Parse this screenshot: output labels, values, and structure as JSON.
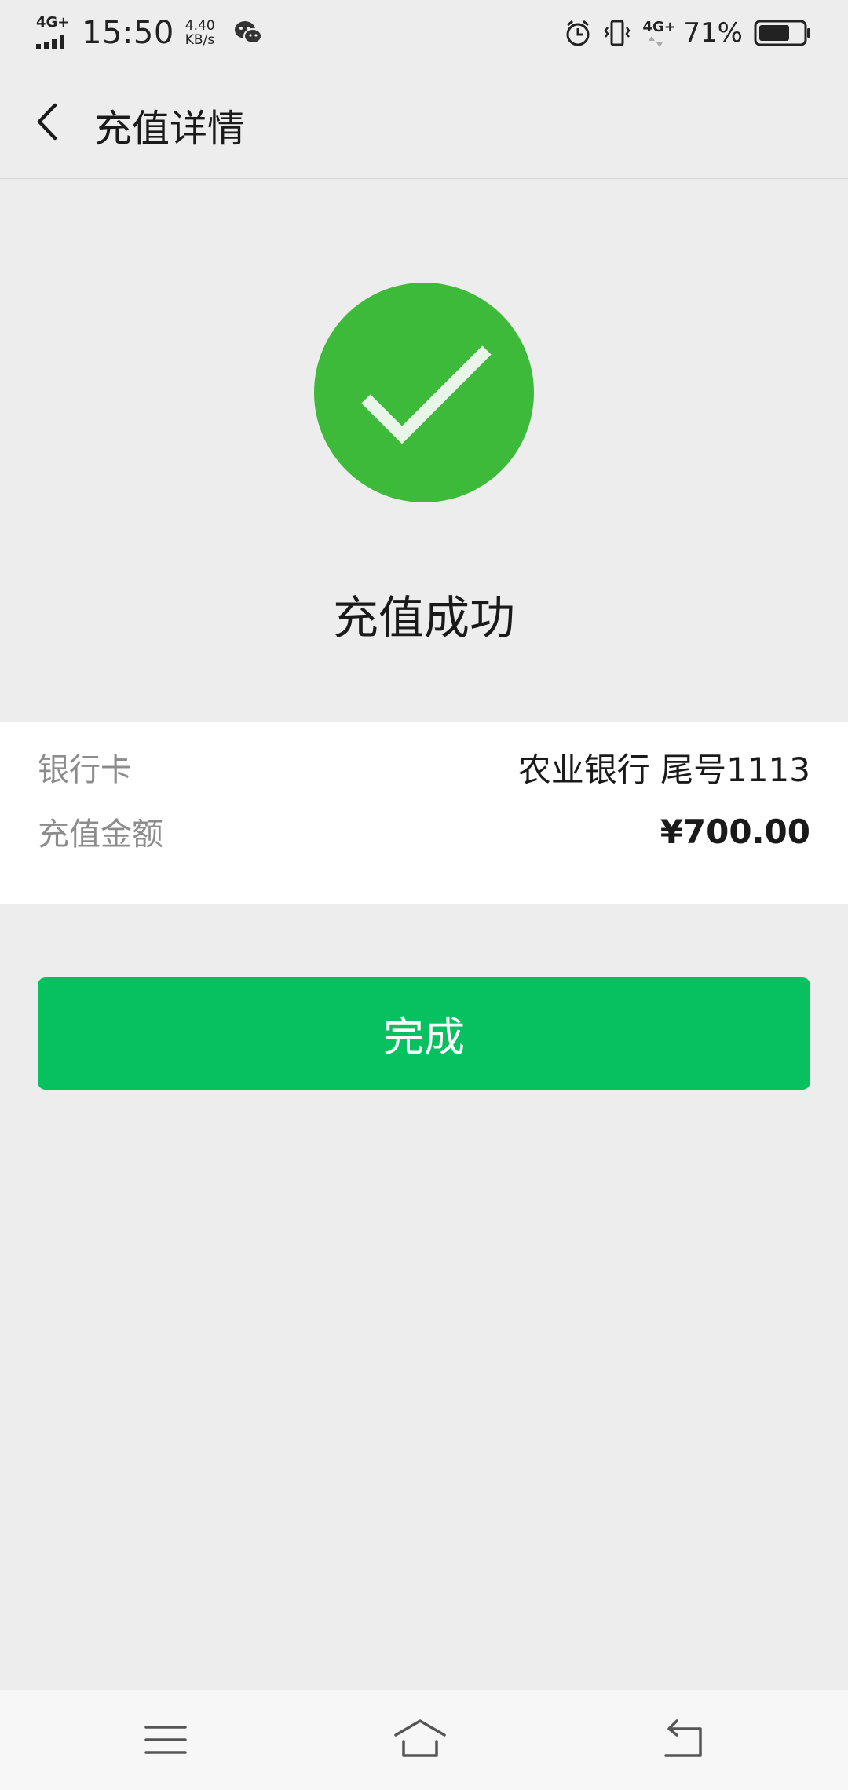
{
  "status_bar": {
    "network": "4G+",
    "time": "15:50",
    "speed_value": "4.40",
    "speed_unit": "KB/s",
    "network_right": "4G+",
    "battery_percent": "71%",
    "battery_level": 0.71,
    "icons": [
      "signal-icon",
      "wechat-icon",
      "alarm-icon",
      "vibrate-icon",
      "battery-icon"
    ]
  },
  "nav": {
    "back_icon": "chevron-left-icon",
    "title": "充值详情"
  },
  "result": {
    "icon": "check-circle-icon",
    "title": "充值成功",
    "accent_color": "#3dba3a"
  },
  "details": {
    "rows": [
      {
        "label": "银行卡",
        "value": "农业银行 尾号1113"
      },
      {
        "label": "充值金额",
        "value": "¥700.00"
      }
    ]
  },
  "actions": {
    "done_label": "完成",
    "button_color": "#07c160"
  },
  "system_nav": {
    "icons": [
      "menu-icon",
      "home-icon",
      "back-icon"
    ]
  }
}
